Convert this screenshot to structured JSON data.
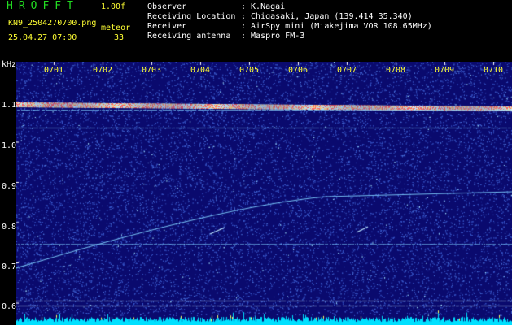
{
  "header": {
    "app_title": "HROFFT",
    "version": "1.00f",
    "filename": "KN9_2504270700.png",
    "meteor_label": "meteor",
    "timestamp": "25.04.27 07:00",
    "meteor_count": "33"
  },
  "info": [
    {
      "key": "Observer",
      "value": ": K.Nagai"
    },
    {
      "key": "Receiving Location",
      "value": ": Chigasaki, Japan (139.414 35.340)"
    },
    {
      "key": "Receiver",
      "value": ": AirSpy mini (Miakejima VOR 108.65MHz)"
    },
    {
      "key": "Receiving antenna",
      "value": ": Maspro FM-3"
    }
  ],
  "spectrogram": {
    "unit": "kHz",
    "y_ticks": [
      "1.1",
      "1.0",
      "0.9",
      "0.8",
      "0.7",
      "0.6"
    ],
    "x_ticks": [
      "0701",
      "0702",
      "0703",
      "0704",
      "0705",
      "0706",
      "0707",
      "0708",
      "0709",
      "0710"
    ],
    "colors": {
      "background": "#0a0a6e",
      "noise": "#3a5acc",
      "trace": "#7fd0ff",
      "hot": "#ff6060",
      "bottom": "#00e0ff",
      "tick_text": "#ffff33"
    }
  }
}
